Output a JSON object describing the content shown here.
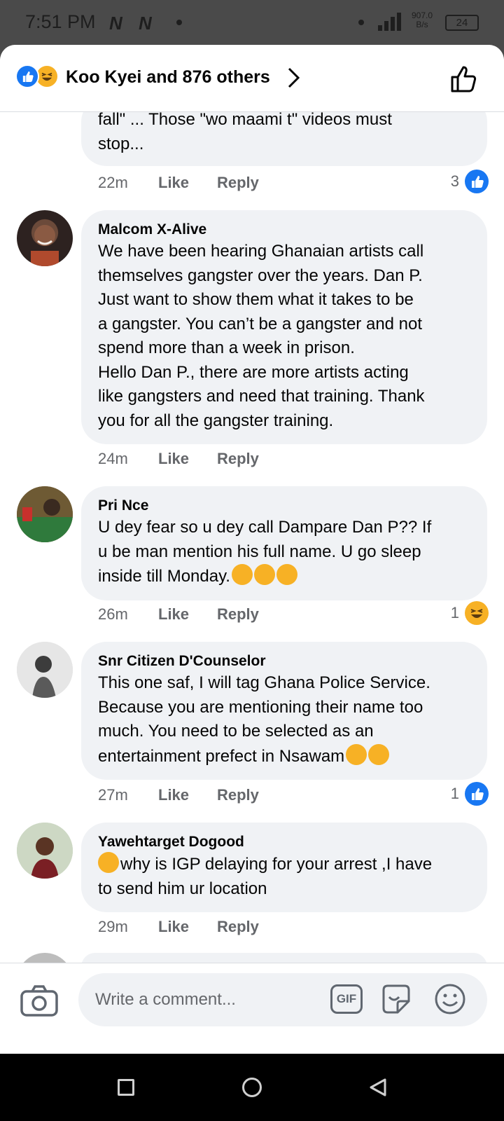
{
  "status": {
    "time": "7:51 PM",
    "net_speed_value": "907.0",
    "net_speed_unit": "B/s",
    "battery": "24"
  },
  "header": {
    "title": "Koo Kyei and 876 others"
  },
  "partial_comment": {
    "text": "fall\" ... Those \"wo maami t\" videos must\nstop...",
    "age": "22m",
    "like_label": "Like",
    "reply_label": "Reply",
    "reaction_count": "3"
  },
  "comments": [
    {
      "author": "Malcom X-Alive",
      "text": "We have been hearing Ghanaian artists call\nthemselves gangster over the years. Dan P.\nJust want to show them what it takes to be\na gangster. You can’t be a gangster and not\nspend more than a week in prison.\nHello Dan P., there are more artists acting\nlike gangsters and need that training. Thank\nyou for all the gangster training.",
      "age": "24m",
      "like_label": "Like",
      "reply_label": "Reply"
    },
    {
      "author": "Pri Nce",
      "text": "U dey fear so u dey call Dampare Dan P?? If\nu be man mention his full name. U go sleep\ninside till Monday.",
      "age": "26m",
      "like_label": "Like",
      "reply_label": "Reply",
      "reaction_count": "1"
    },
    {
      "author": "Snr Citizen D'Counselor",
      "text": "This one saf, I will tag Ghana Police Service.\nBecause you are mentioning their name too\nmuch. You need to be selected as an\nentertainment prefect in Nsawam",
      "age": "27m",
      "like_label": "Like",
      "reply_label": "Reply",
      "reaction_count": "1"
    },
    {
      "author": "Yawehtarget Dogood",
      "text": "why is IGP delaying for your arrest ,I have\nto send him ur location",
      "age": "29m",
      "like_label": "Like",
      "reply_label": "Reply"
    }
  ],
  "composer": {
    "placeholder": "Write a comment...",
    "gif_label": "GIF"
  },
  "colors": {
    "brand_blue": "#1877f2",
    "bubble_bg": "#f0f2f5",
    "meta_gray": "#65676b",
    "emoji_yellow": "#f7b125"
  },
  "icons": [
    "like-reaction-icon",
    "haha-reaction-icon",
    "chevron-right-icon",
    "thumbs-up-outline-icon",
    "camera-icon",
    "gif-icon",
    "sticker-icon",
    "smiley-icon",
    "recents-icon",
    "home-icon",
    "back-icon"
  ]
}
